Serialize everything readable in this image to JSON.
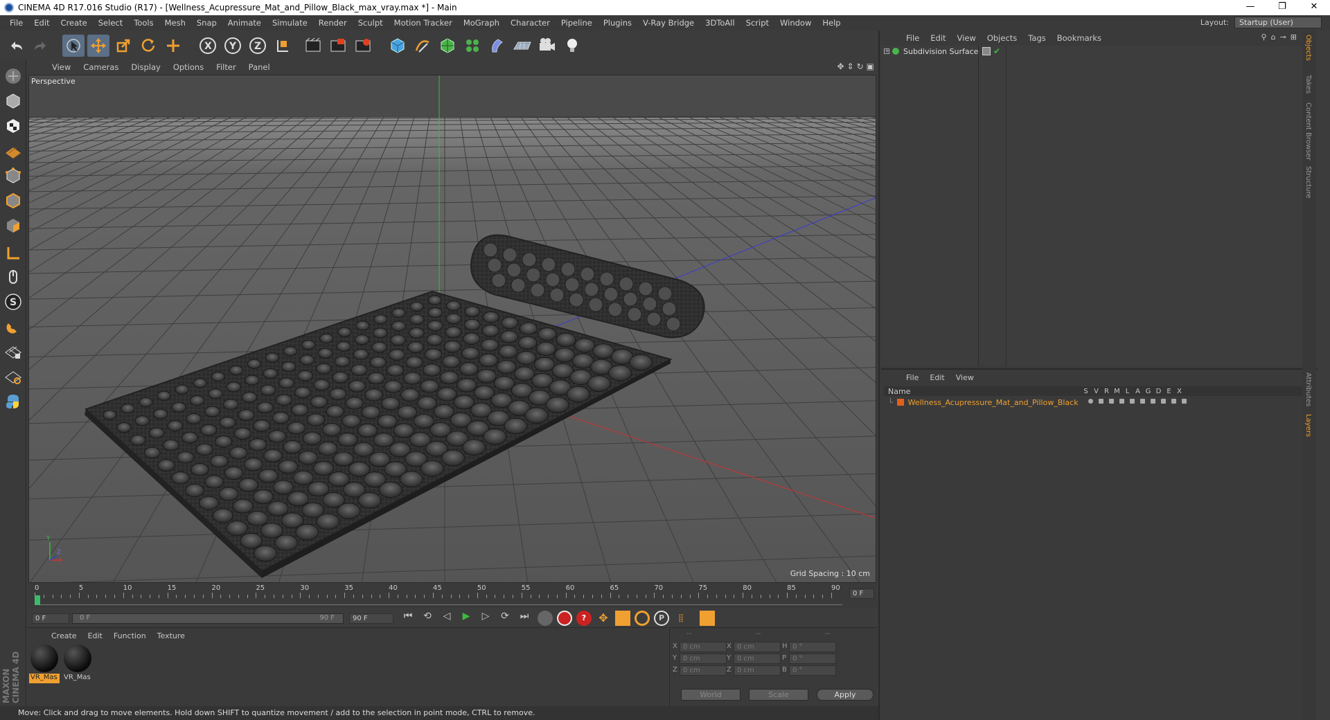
{
  "titlebar": {
    "title": "CINEMA 4D R17.016 Studio (R17) - [Wellness_Acupressure_Mat_and_Pillow_Black_max_vray.max *] - Main",
    "minimize": "—",
    "maximize": "❐",
    "close": "✕"
  },
  "menubar": {
    "items": [
      "File",
      "Edit",
      "Create",
      "Select",
      "Tools",
      "Mesh",
      "Snap",
      "Animate",
      "Simulate",
      "Render",
      "Sculpt",
      "Motion Tracker",
      "MoGraph",
      "Character",
      "Pipeline",
      "Plugins",
      "V-Ray Bridge",
      "3DToAll",
      "Script",
      "Window",
      "Help"
    ],
    "layout_label": "Layout:",
    "layout_value": "Startup (User)"
  },
  "viewport": {
    "menu": [
      "View",
      "Cameras",
      "Display",
      "Options",
      "Filter",
      "Panel"
    ],
    "camera_label": "Perspective",
    "grid_spacing": "Grid Spacing : 10 cm",
    "axis_y": "Y",
    "axis_x": "X",
    "axis_z": "Z"
  },
  "timeline": {
    "ticks": [
      "0",
      "5",
      "10",
      "15",
      "20",
      "25",
      "30",
      "35",
      "40",
      "45",
      "50",
      "55",
      "60",
      "65",
      "70",
      "75",
      "80",
      "85",
      "90"
    ],
    "current_frame": "0 F",
    "start_field": "0 F",
    "range_start": "0 F",
    "range_end": "90 F",
    "end_field": "90 F"
  },
  "materials": {
    "menu": [
      "Create",
      "Edit",
      "Function",
      "Texture"
    ],
    "items": [
      {
        "label": "VR_Mas",
        "selected": true
      },
      {
        "label": "VR_Mas",
        "selected": false
      }
    ]
  },
  "coords": {
    "headers": [
      "--",
      "--",
      "--"
    ],
    "rows": [
      {
        "a_label": "X",
        "a_val": "0 cm",
        "b_label": "X",
        "b_val": "0 cm",
        "c_label": "H",
        "c_val": "0 °"
      },
      {
        "a_label": "Y",
        "a_val": "0 cm",
        "b_label": "Y",
        "b_val": "0 cm",
        "c_label": "P",
        "c_val": "0 °"
      },
      {
        "a_label": "Z",
        "a_val": "0 cm",
        "b_label": "Z",
        "b_val": "0 cm",
        "c_label": "B",
        "c_val": "0 °"
      }
    ],
    "world": "World",
    "scale": "Scale",
    "apply": "Apply"
  },
  "branding": "MAXON CINEMA 4D",
  "statusbar": "Move: Click and drag to move elements. Hold down SHIFT to quantize movement / add to the selection in point mode, CTRL to remove.",
  "object_manager": {
    "menu": [
      "File",
      "Edit",
      "View",
      "Objects",
      "Tags",
      "Bookmarks"
    ],
    "objects": [
      {
        "name": "Subdivision Surface"
      }
    ]
  },
  "layer_manager": {
    "menu": [
      "File",
      "Edit",
      "View"
    ],
    "columns": {
      "name": "Name",
      "flags": [
        "S",
        "V",
        "R",
        "M",
        "L",
        "A",
        "G",
        "D",
        "E",
        "X"
      ]
    },
    "layers": [
      {
        "name": "Wellness_Acupressure_Mat_and_Pillow_Black"
      }
    ]
  },
  "side_tabs": [
    "Objects",
    "Takes",
    "Content Browser",
    "Structure",
    "Attributes",
    "Layers"
  ],
  "colors": {
    "accent_orange": "#f0a030",
    "layer_name": "#f0a030",
    "axis_green": "#3dbb3d",
    "axis_red": "#c33",
    "axis_blue": "#3b3bd0"
  }
}
